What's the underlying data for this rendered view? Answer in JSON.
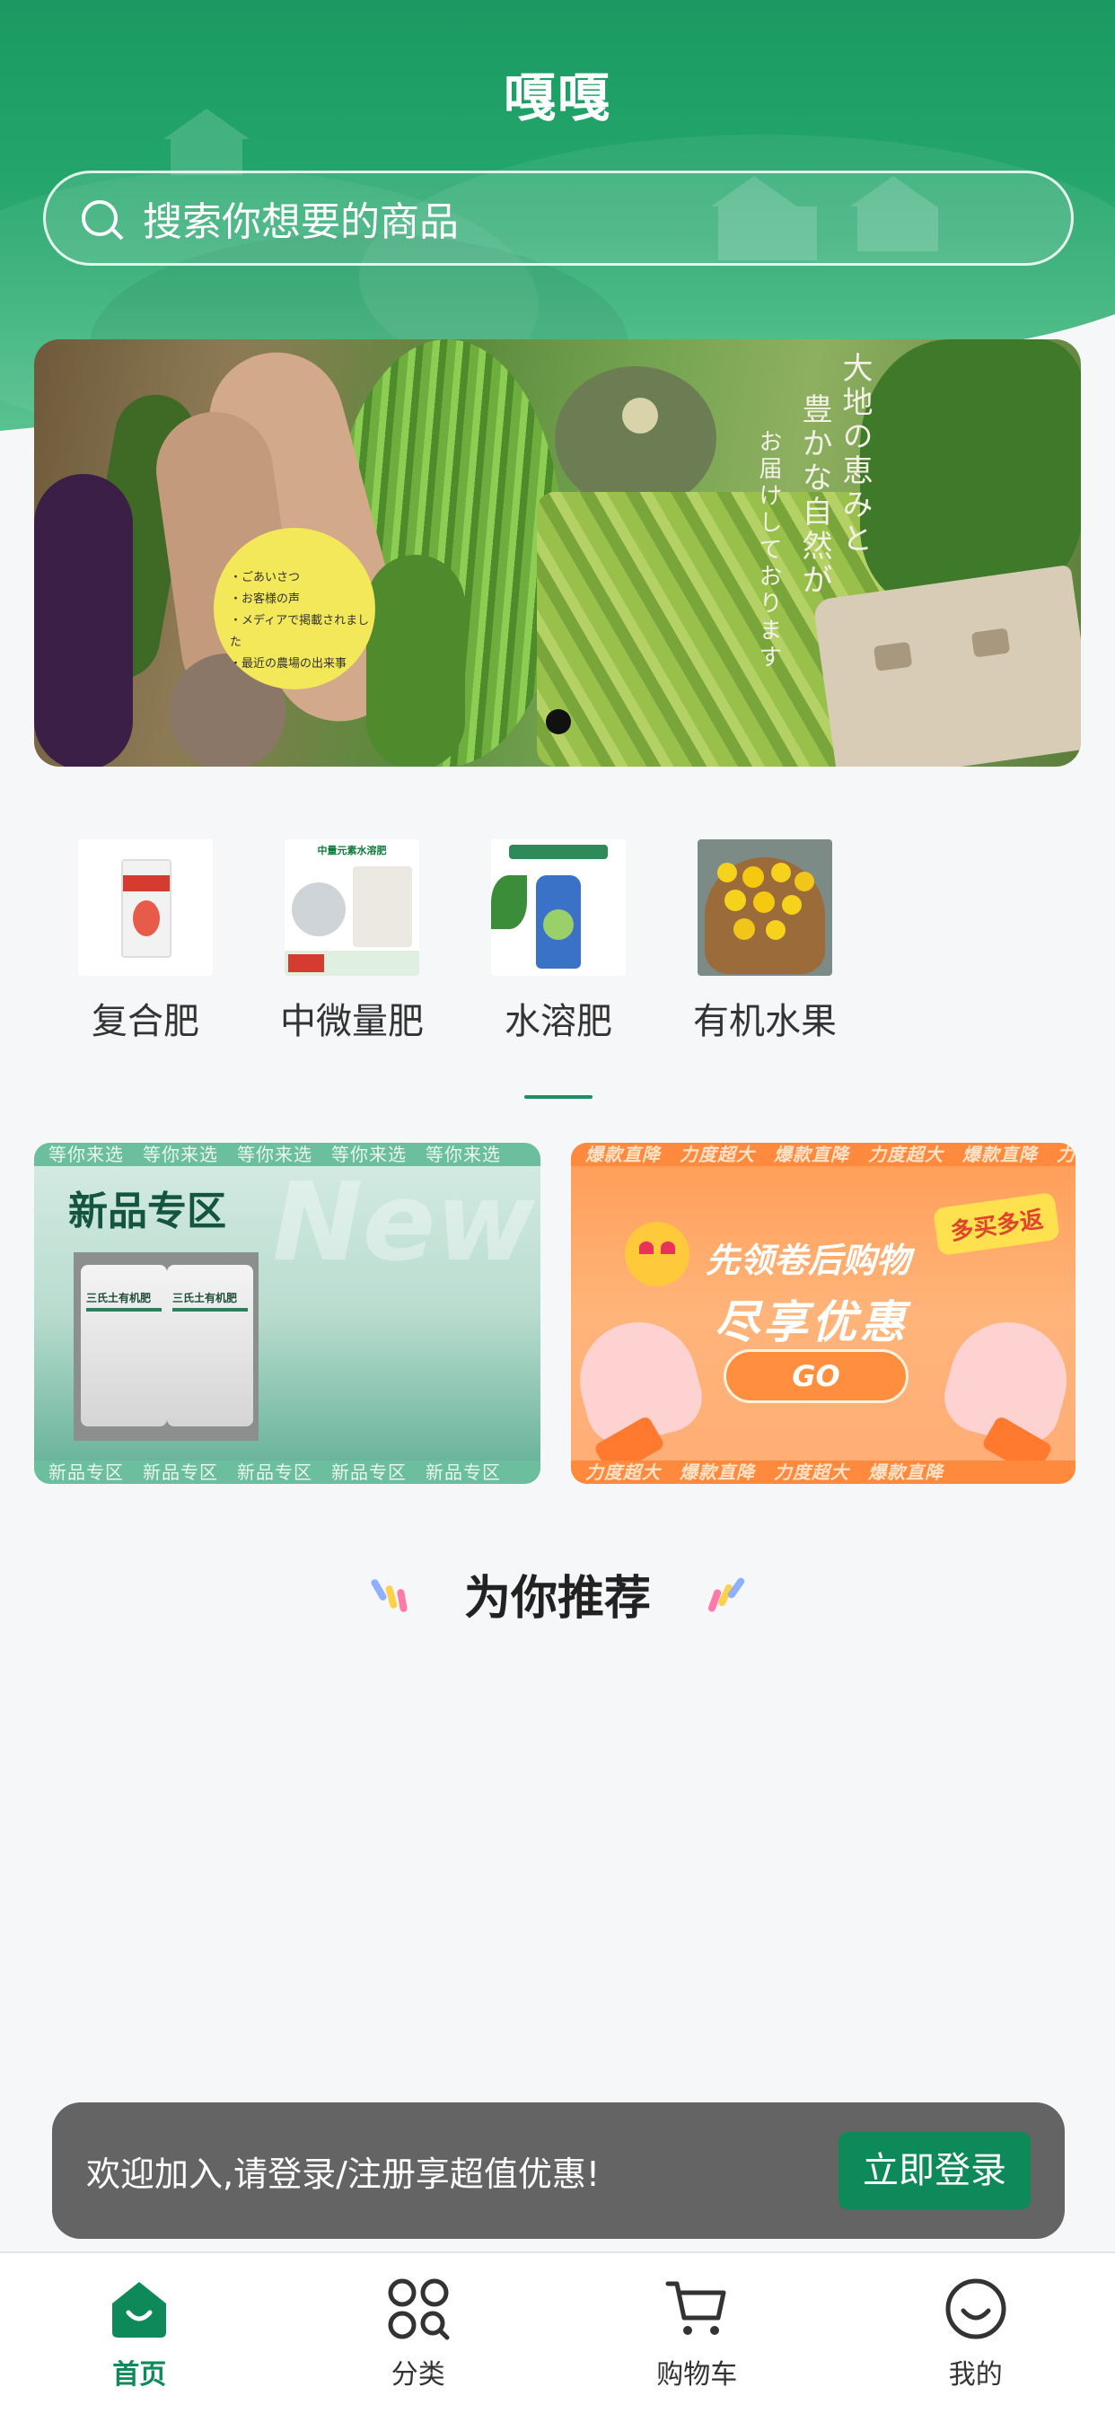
{
  "app": {
    "title": "嘎嘎"
  },
  "search": {
    "placeholder": "搜索你想要的商品"
  },
  "banner": {
    "tag_lines": [
      "・ごあいさつ",
      "・お客様の声",
      "・メディアで掲載されました",
      "・最近の農場の出来事"
    ],
    "vertical_text": [
      "大地の恵みと",
      "豊かな自然が",
      "お届けしております"
    ],
    "active_dot": 1
  },
  "categories": [
    {
      "label": "复合肥",
      "icon": "fertilizer-bag"
    },
    {
      "label": "中微量肥",
      "icon": "trace-element-bag"
    },
    {
      "label": "水溶肥",
      "icon": "water-soluble-bottle"
    },
    {
      "label": "有机水果",
      "icon": "fruit-basket"
    }
  ],
  "promo_new": {
    "title": "新品专区",
    "top_strip": "等你来选　等你来选　等你来选　等你来选　等你来选",
    "bottom_strip": "新品专区　新品专区　新品专区　新品专区　新品专区",
    "watermark": "New",
    "bag_label": "三氏土有机肥"
  },
  "promo_deal": {
    "line1": "先领卷后购物",
    "line2": "尽享优惠",
    "badge": "多买多返",
    "go": "GO",
    "top_strip": "爆款直降　力度超大　爆款直降　力度超大　爆款直降　力度超大",
    "bottom_strip": "力度超大　爆款直降　力度超大　爆款直降"
  },
  "recommend": {
    "title": "为你推荐"
  },
  "login_bar": {
    "text": "欢迎加入,请登录/注册享超值优惠!",
    "button": "立即登录"
  },
  "tabbar": [
    {
      "label": "首页",
      "icon": "home-icon",
      "active": true
    },
    {
      "label": "分类",
      "icon": "category-icon",
      "active": false
    },
    {
      "label": "购物车",
      "icon": "cart-icon",
      "active": false
    },
    {
      "label": "我的",
      "icon": "profile-icon",
      "active": false
    }
  ],
  "colors": {
    "brand_green": "#0e8a5a",
    "header_green": "#1a9a62",
    "deal_orange": "#ff9c55"
  }
}
